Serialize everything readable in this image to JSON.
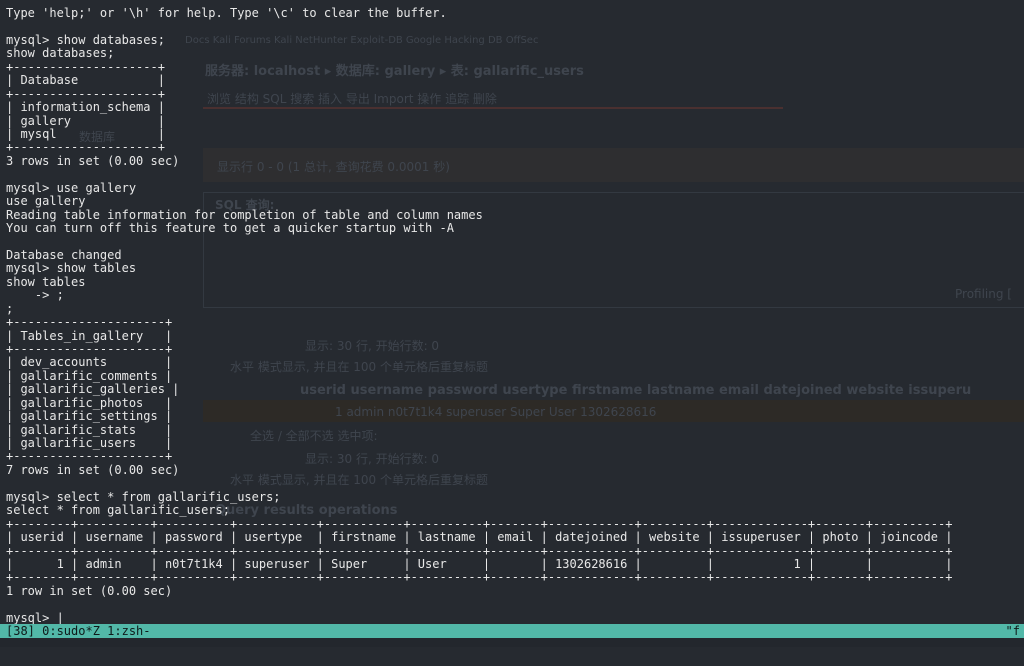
{
  "terminal": {
    "lines": [
      "Type 'help;' or '\\h' for help. Type '\\c' to clear the buffer.",
      "",
      "mysql> show databases;",
      "show databases;",
      "+--------------------+",
      "| Database           |",
      "+--------------------+",
      "| information_schema |",
      "| gallery            |",
      "| mysql              |",
      "+--------------------+",
      "3 rows in set (0.00 sec)",
      "",
      "mysql> use gallery",
      "use gallery",
      "Reading table information for completion of table and column names",
      "You can turn off this feature to get a quicker startup with -A",
      "",
      "Database changed",
      "mysql> show tables",
      "show tables",
      "    -> ;",
      ";",
      "+---------------------+",
      "| Tables_in_gallery   |",
      "+---------------------+",
      "| dev_accounts        |",
      "| gallarific_comments |",
      "| gallarific_galleries |",
      "| gallarific_photos   |",
      "| gallarific_settings |",
      "| gallarific_stats    |",
      "| gallarific_users    |",
      "+---------------------+",
      "7 rows in set (0.00 sec)",
      "",
      "mysql> select * from gallarific_users;",
      "select * from gallarific_users;",
      "+--------+----------+----------+-----------+-----------+----------+-------+------------+---------+-------------+-------+----------+",
      "| userid | username | password | usertype  | firstname | lastname | email | datejoined | website | issuperuser | photo | joincode |",
      "+--------+----------+----------+-----------+-----------+----------+-------+------------+---------+-------------+-------+----------+",
      "|      1 | admin    | n0t7t1k4 | superuser | Super     | User     |       | 1302628616 |         |           1 |       |          |",
      "+--------+----------+----------+-----------+-----------+----------+-------+------------+---------+-------------+-------+----------+",
      "1 row in set (0.00 sec)",
      "",
      "mysql> |"
    ]
  },
  "statusbar": {
    "left": "[38] 0:sudo*Z 1:zsh-",
    "right": "\"f"
  },
  "ghost": {
    "bookmarks": "Docs  Kali Forums  Kali NetHunter  Exploit-DB  Google Hacking DB  OffSec",
    "breadcrumb": "服务器: localhost ▸  数据库: gallery ▸  表: gallarific_users",
    "toolbar": "浏览   结构   SQL   搜索   插入   导出   Import   操作   追踪   删除",
    "sidebar_item": "数据库",
    "result_msg": "显示行 0 - 0 (1 总计, 查询花费 0.0001 秒)",
    "sql_label": "SQL 查询:",
    "profiling": "Profiling [",
    "nav1": "显示:  30     行, 开始行数:  0",
    "nav2": "水平          模式显示, 并且在  100   个单元格后重复标题",
    "columns": "userid   username   password   usertype   firstname   lastname   email   datejoined   website   issuperu",
    "datarow": "1    admin     n0t7t1k4   superuser   Super     User             1302628616",
    "check_all": "全选 / 全部不选  选中项:",
    "ops": "Query results operations"
  },
  "colors": {
    "background": "#262a30",
    "text": "#e8e8e8",
    "statusbar": "#52b8a8"
  }
}
